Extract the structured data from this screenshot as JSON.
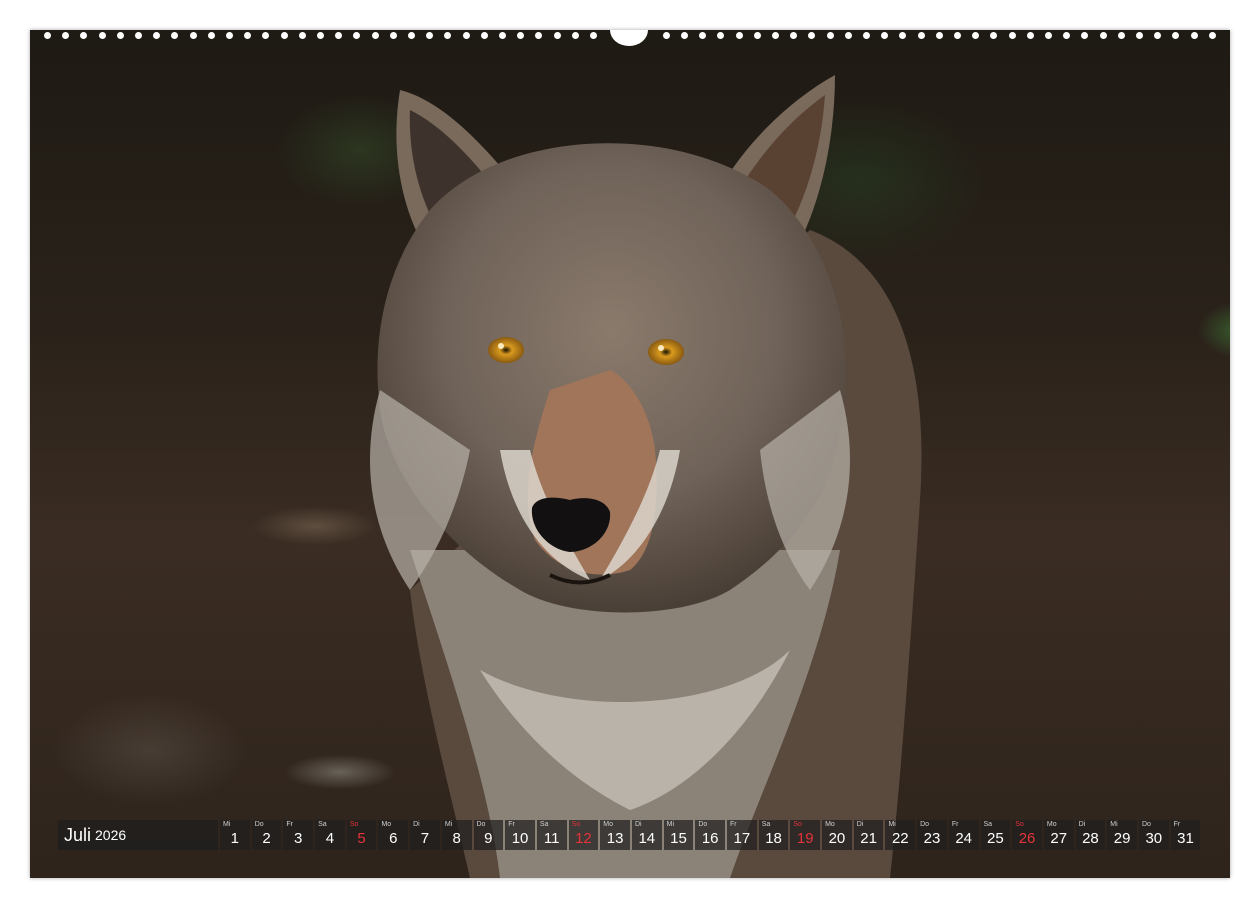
{
  "calendar": {
    "month": "Juli",
    "year": "2026",
    "days": [
      {
        "wd": "Mi",
        "n": "1"
      },
      {
        "wd": "Do",
        "n": "2"
      },
      {
        "wd": "Fr",
        "n": "3"
      },
      {
        "wd": "Sa",
        "n": "4"
      },
      {
        "wd": "So",
        "n": "5",
        "sun": true
      },
      {
        "wd": "Mo",
        "n": "6"
      },
      {
        "wd": "Di",
        "n": "7"
      },
      {
        "wd": "Mi",
        "n": "8"
      },
      {
        "wd": "Do",
        "n": "9"
      },
      {
        "wd": "Fr",
        "n": "10"
      },
      {
        "wd": "Sa",
        "n": "11"
      },
      {
        "wd": "So",
        "n": "12",
        "sun": true
      },
      {
        "wd": "Mo",
        "n": "13"
      },
      {
        "wd": "Di",
        "n": "14"
      },
      {
        "wd": "Mi",
        "n": "15"
      },
      {
        "wd": "Do",
        "n": "16"
      },
      {
        "wd": "Fr",
        "n": "17"
      },
      {
        "wd": "Sa",
        "n": "18"
      },
      {
        "wd": "So",
        "n": "19",
        "sun": true
      },
      {
        "wd": "Mo",
        "n": "20"
      },
      {
        "wd": "Di",
        "n": "21"
      },
      {
        "wd": "Mi",
        "n": "22"
      },
      {
        "wd": "Do",
        "n": "23"
      },
      {
        "wd": "Fr",
        "n": "24"
      },
      {
        "wd": "Sa",
        "n": "25"
      },
      {
        "wd": "So",
        "n": "26",
        "sun": true
      },
      {
        "wd": "Mo",
        "n": "27"
      },
      {
        "wd": "Di",
        "n": "28"
      },
      {
        "wd": "Mi",
        "n": "29"
      },
      {
        "wd": "Do",
        "n": "30"
      },
      {
        "wd": "Fr",
        "n": "31"
      }
    ]
  },
  "colors": {
    "sunday": "#e5333a",
    "strip": "#1e1e1e"
  }
}
